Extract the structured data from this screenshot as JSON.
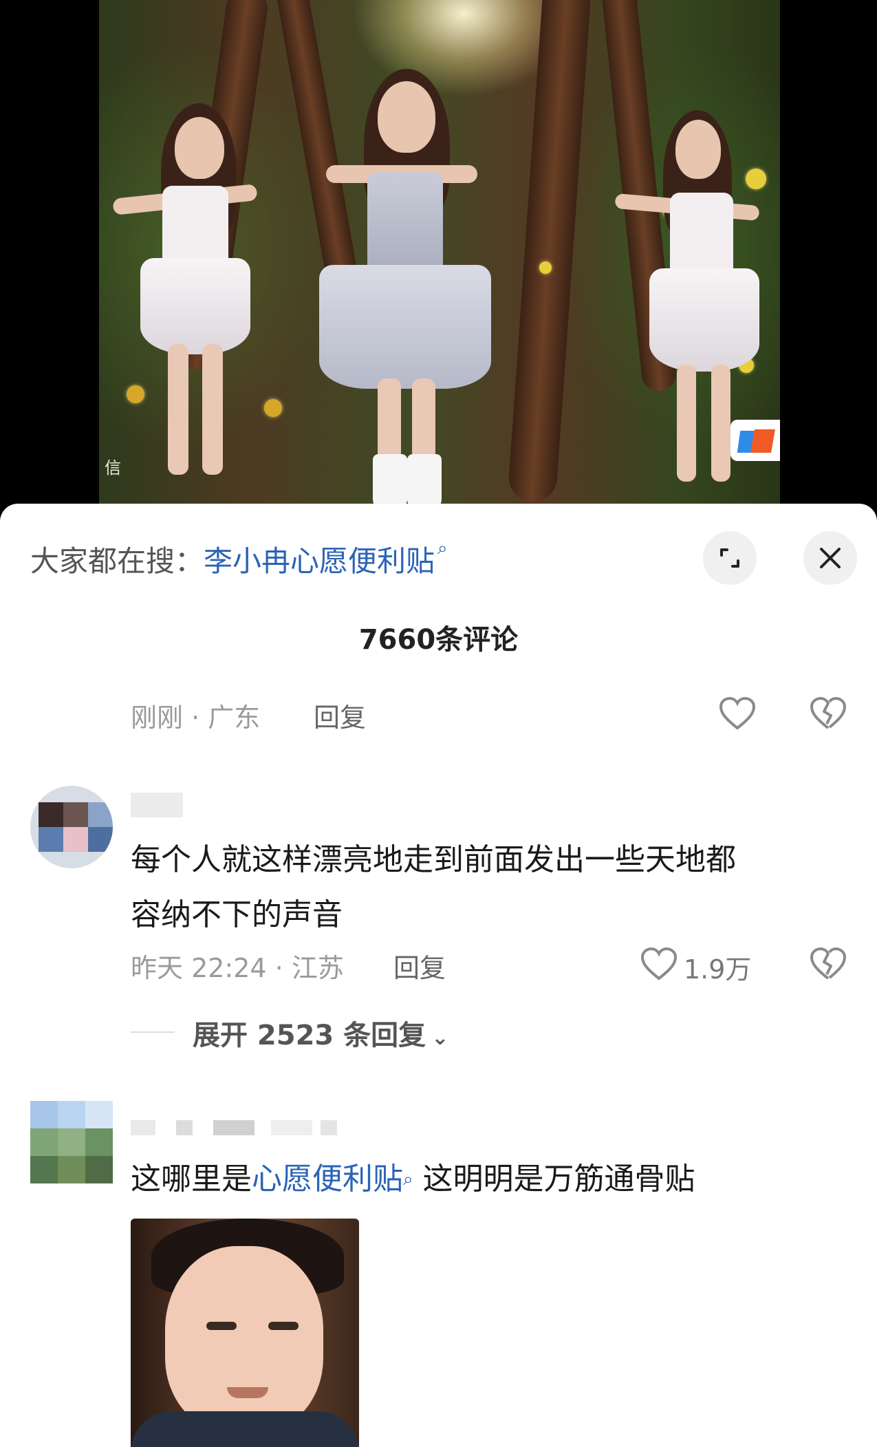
{
  "video": {
    "watermark_char": "信",
    "logo": "mango-tv-logo"
  },
  "sheet": {
    "search_prefix": "大家都在搜：",
    "search_keyword": "李小冉心愿便利贴",
    "comment_count_title": "7660条评论",
    "expand_icon": "expand-icon",
    "close_icon": "close-icon"
  },
  "comments": [
    {
      "time_location": "刚刚 · 广东",
      "reply_label": "回复"
    },
    {
      "text": [
        "每个人就这样漂亮地走到前面发出一些天地都",
        "容纳不下的声音"
      ],
      "time_location": "昨天 22:24 · 江苏",
      "reply_label": "回复",
      "likes": "1.9万",
      "expand_replies": "展开 2523 条回复"
    },
    {
      "text_before": "这哪里是",
      "text_keyword": "心愿便利贴",
      "text_after": " 这明明是万筋通骨贴"
    }
  ],
  "colors": {
    "accent_link": "#2b63b6",
    "meta_gray": "#9a9a9a",
    "sheet_bg": "#ffffff"
  }
}
